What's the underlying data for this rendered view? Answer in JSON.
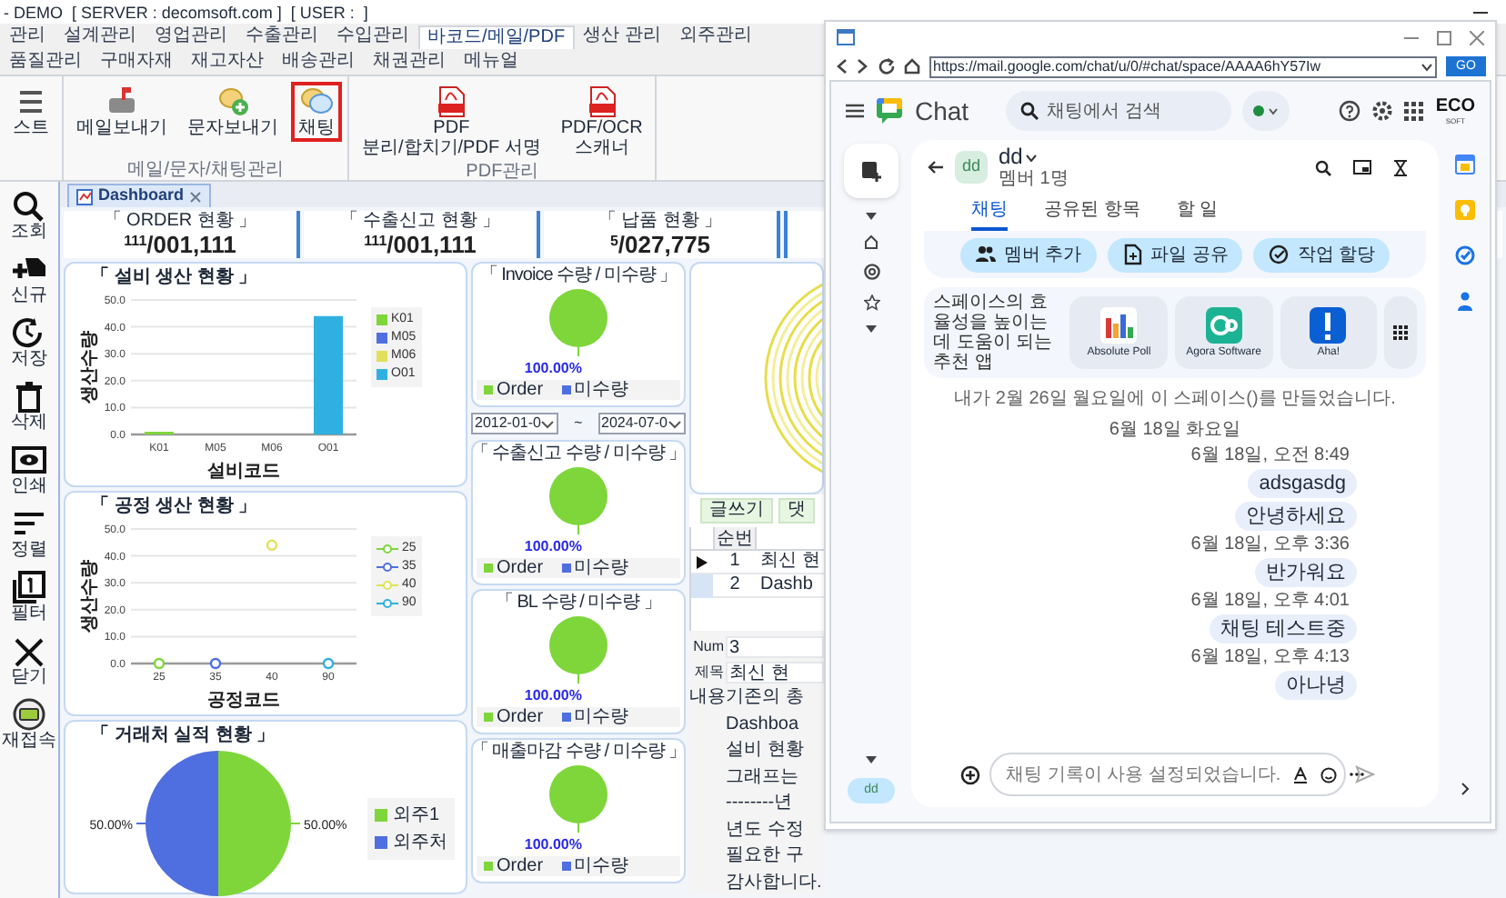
{
  "title_bar": {
    "text": "- DEMO  [ SERVER : decomsoft.com ]  [ USER :  ]"
  },
  "menu_tabs": [
    {
      "label": "관리",
      "selected": false
    },
    {
      "label": "설계관리",
      "selected": false
    },
    {
      "label": "영업관리",
      "selected": false
    },
    {
      "label": "수출관리",
      "selected": false
    },
    {
      "label": "수입관리",
      "selected": false
    },
    {
      "label": "바코드/메일/PDF",
      "selected": true
    },
    {
      "label": "생산 관리",
      "selected": false
    },
    {
      "label": "외주관리",
      "selected": false
    },
    {
      "label": "품질관리",
      "selected": false
    },
    {
      "label": "구매자재",
      "selected": false
    },
    {
      "label": "재고자산",
      "selected": false
    },
    {
      "label": "배송관리",
      "selected": false
    },
    {
      "label": "채권관리",
      "selected": false
    },
    {
      "label": "메뉴얼",
      "selected": false
    }
  ],
  "ribbon": {
    "groups": [
      {
        "items": [
          {
            "kind": "list",
            "lines": [
              "스트"
            ],
            "selected": false
          }
        ]
      },
      {
        "label": "메일/문자/채팅관리",
        "items": [
          {
            "kind": "mail",
            "lines": [
              "메일보내기"
            ],
            "selected": false
          },
          {
            "kind": "sms",
            "lines": [
              "문자보내기"
            ],
            "selected": false
          },
          {
            "kind": "chat",
            "lines": [
              "채팅"
            ],
            "selected": true
          }
        ]
      },
      {
        "label": "PDF관리",
        "items": [
          {
            "kind": "pdf",
            "lines": [
              "PDF",
              "분리/합치기/PDF 서명"
            ],
            "selected": false
          },
          {
            "kind": "pdf",
            "lines": [
              "PDF/OCR",
              "스캐너"
            ],
            "selected": false
          }
        ]
      }
    ]
  },
  "sidebar_tools": [
    {
      "kind": "search",
      "label": "조회"
    },
    {
      "kind": "new",
      "label": "신규"
    },
    {
      "kind": "save",
      "label": "저장"
    },
    {
      "kind": "delete",
      "label": "삭제"
    },
    {
      "kind": "print",
      "label": "인쇄"
    },
    {
      "kind": "sort",
      "label": "정렬"
    },
    {
      "kind": "filter",
      "label": "필터"
    },
    {
      "kind": "close",
      "label": "닫기"
    },
    {
      "kind": "reconnect",
      "label": "재접속"
    }
  ],
  "document_tab": {
    "label": "Dashboard"
  },
  "kpis": [
    {
      "title": "「 ORDER 현황 」",
      "count": "111",
      "value": "/001,111"
    },
    {
      "title": "「 수출신고 현황 」",
      "count": "111",
      "value": "/001,111"
    },
    {
      "title": "「 납품 현황 」",
      "count": "5",
      "value": "/027,775"
    }
  ],
  "equipment_chart": {
    "chart_data": {
      "type": "bar",
      "title": "「 설비 생산 현황 」",
      "xlabel": "설비코드",
      "ylabel": "생산수량",
      "categories": [
        "K01",
        "M05",
        "M06",
        "O01"
      ],
      "series": [
        {
          "name": "K01",
          "color": "#7ed63b",
          "values": [
            1,
            null,
            null,
            null
          ]
        },
        {
          "name": "M05",
          "color": "#4f6fe0",
          "values": [
            null,
            0,
            null,
            null
          ]
        },
        {
          "name": "M06",
          "color": "#e2e05a",
          "values": [
            null,
            null,
            0,
            null
          ]
        },
        {
          "name": "O01",
          "color": "#2fb0e0",
          "values": [
            null,
            null,
            null,
            44
          ]
        }
      ],
      "grid": true,
      "ylim": [
        0,
        50
      ],
      "yticks": [
        {
          "value": 0,
          "label": "0.0"
        },
        {
          "value": 10,
          "label": "10.0"
        },
        {
          "value": 20,
          "label": "20.0"
        },
        {
          "value": 30,
          "label": "30.0"
        },
        {
          "value": 40,
          "label": "40.0"
        },
        {
          "value": 50,
          "label": "50.0"
        }
      ]
    }
  },
  "process_chart": {
    "chart_data": {
      "type": "line",
      "title": "「 공정 생산 현황 」",
      "xlabel": "공정코드",
      "ylabel": "생산수량",
      "categories": [
        "25",
        "35",
        "40",
        "90"
      ],
      "series": [
        {
          "name": "25",
          "color": "#7ed63b",
          "marker": "circle",
          "values": [
            0,
            null,
            null,
            null
          ]
        },
        {
          "name": "35",
          "color": "#4f6fe0",
          "marker": "circle",
          "values": [
            null,
            0,
            null,
            null
          ]
        },
        {
          "name": "40",
          "color": "#e2e05a",
          "marker": "circle",
          "values": [
            null,
            null,
            44,
            null
          ]
        },
        {
          "name": "90",
          "color": "#2fb0e0",
          "marker": "circle",
          "values": [
            null,
            null,
            null,
            0
          ]
        }
      ],
      "grid": true,
      "ylim": [
        0,
        50
      ],
      "yticks": [
        {
          "value": 0,
          "label": "0.0"
        },
        {
          "value": 10,
          "label": "10.0"
        },
        {
          "value": 20,
          "label": "20.0"
        },
        {
          "value": 30,
          "label": "30.0"
        },
        {
          "value": 40,
          "label": "40.0"
        },
        {
          "value": 50,
          "label": "50.0"
        }
      ]
    }
  },
  "client_chart": {
    "chart_data": {
      "type": "pie",
      "title": "「 거래처 실적 현황 」",
      "categories": [
        "외주1",
        "외주처"
      ],
      "values": [
        50,
        50
      ],
      "value_labels": [
        "50.00%",
        "50.00%"
      ]
    }
  },
  "status_pies": [
    {
      "chart_data": {
        "type": "pie",
        "title": "「 Invoice 수량 / 미수량 」",
        "categories": [
          "Order",
          "미수량"
        ],
        "values": [
          100,
          0
        ],
        "value_labels": [
          "100.00%",
          null
        ]
      }
    },
    {
      "chart_data": {
        "type": "pie",
        "title": "「 수출신고 수량 / 미수량 」",
        "categories": [
          "Order",
          "미수량"
        ],
        "values": [
          100,
          0
        ],
        "value_labels": [
          "100.00%",
          null
        ]
      }
    },
    {
      "chart_data": {
        "type": "pie",
        "title": "「 BL 수량 / 미수량 」",
        "categories": [
          "Order",
          "미수량"
        ],
        "values": [
          100,
          0
        ],
        "value_labels": [
          "100.00%",
          null
        ]
      }
    },
    {
      "chart_data": {
        "type": "pie",
        "title": "「 매출마감 수량 / 미수량 」",
        "categories": [
          "Order",
          "미수량"
        ],
        "values": [
          100,
          0
        ],
        "value_labels": [
          "100.00%",
          null
        ]
      }
    }
  ],
  "date_range": {
    "from": "2012-01-0",
    "separator": "~",
    "to": "2024-07-0"
  },
  "board": {
    "buttons": [
      "글쓰기",
      "댓"
    ],
    "columns": [
      "순번"
    ],
    "rows": [
      {
        "selected": true,
        "number": "1",
        "title": "최신 현"
      },
      {
        "selected": false,
        "number": "2",
        "title": "Dashb"
      }
    ]
  },
  "detail": {
    "fields": [
      {
        "label": "Num",
        "value": "3"
      },
      {
        "label": "제목",
        "value": "최신 현"
      }
    ],
    "content_label": "내용",
    "content_lines": [
      "기존의 총",
      "Dashboa",
      "설비 현황",
      "그래프는",
      "--------년",
      "년도 수정",
      "필요한 구",
      "감사합니다."
    ]
  },
  "chat_window": {
    "url": "https://mail.google.com/chat/u/0/#chat/space/AAAA6hY57Iw",
    "go_button": "GO",
    "app_name": "Chat",
    "search_placeholder": "채팅에서 검색",
    "brand": [
      "ECO",
      "SOFT"
    ],
    "space": {
      "avatar": "dd",
      "name": "dd",
      "members": "멤버 1명"
    },
    "tabs": [
      {
        "label": "채팅",
        "selected": true
      },
      {
        "label": "공유된 항목",
        "selected": false
      },
      {
        "label": "할 일",
        "selected": false
      }
    ],
    "actions": [
      {
        "kind": "add_member",
        "label": "멤버 추가"
      },
      {
        "kind": "share_file",
        "label": "파일 공유"
      },
      {
        "kind": "assign_task",
        "label": "작업 할당"
      }
    ],
    "apps_intro": "스페이스의 효율성을 높이는 데 도움이 되는 추천 앱",
    "apps": [
      {
        "kind": "poll",
        "name": "Absolute Poll"
      },
      {
        "kind": "agora",
        "name": "Agora Software"
      },
      {
        "kind": "aha",
        "name": "Aha!"
      }
    ],
    "system_message": "내가 2월 26일 월요일에 이 스페이스()를 만들었습니다.",
    "date_divider": "6월 18일 화요일",
    "messages": [
      {
        "time": "6월 18일, 오전 8:49",
        "texts": [
          "adsgasdg",
          "안녕하세요"
        ]
      },
      {
        "time": "6월 18일, 오후 3:36",
        "texts": [
          "반가워요"
        ]
      },
      {
        "time": "6월 18일, 오후 4:01",
        "texts": [
          "채팅 테스트중"
        ]
      },
      {
        "time": "6월 18일, 오후 4:13",
        "texts": [
          "아나녕"
        ]
      }
    ],
    "composer_placeholder": "채팅 기록이 사용 설정되었습니다.",
    "rail_space": "dd"
  }
}
